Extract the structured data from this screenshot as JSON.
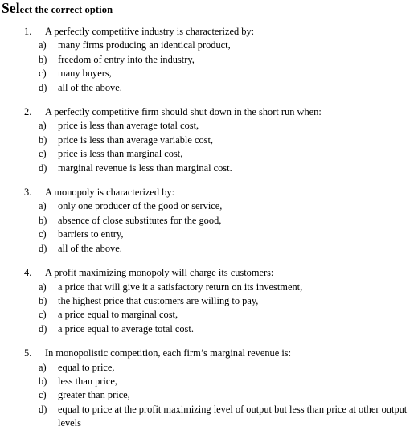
{
  "document": {
    "title_lead": "Sel",
    "title_rest": "ect the correct option",
    "title_full": "Select the correct option",
    "background_color": "#ffffff",
    "text_color": "#000000"
  },
  "questions": [
    {
      "number": "1.",
      "stem": "A perfectly competitive industry is characterized by:",
      "extra_gap_before": false,
      "options": [
        {
          "letter": "a)",
          "text": "many firms producing an identical product,"
        },
        {
          "letter": "b)",
          "text": "freedom of entry into the industry,"
        },
        {
          "letter": "c)",
          "text": "many buyers,"
        },
        {
          "letter": "d)",
          "text": "all of the above."
        }
      ]
    },
    {
      "number": "2.",
      "stem": "A perfectly competitive firm should shut down in the short run when:",
      "extra_gap_before": false,
      "options": [
        {
          "letter": "a)",
          "text": "price is less than average total cost,"
        },
        {
          "letter": "b)",
          "text": "price is less than average variable cost,"
        },
        {
          "letter": "c)",
          "text": "price is less than marginal cost,"
        },
        {
          "letter": "d)",
          "text": "marginal revenue is less than marginal cost."
        }
      ]
    },
    {
      "number": "3.",
      "stem": "A monopoly is characterized by:",
      "extra_gap_before": false,
      "options": [
        {
          "letter": "a)",
          "text": "only one producer of the good or service,"
        },
        {
          "letter": "b)",
          "text": "absence of close substitutes for the good,"
        },
        {
          "letter": "c)",
          "text": "barriers to entry,"
        },
        {
          "letter": "d)",
          "text": "all of the above."
        }
      ]
    },
    {
      "number": "4.",
      "stem": "A profit maximizing monopoly will charge its customers:",
      "extra_gap_before": true,
      "options": [
        {
          "letter": "a)",
          "text": "a price that will give it a satisfactory return on its investment,"
        },
        {
          "letter": "b)",
          "text": "the highest price that customers are willing to pay,"
        },
        {
          "letter": "c)",
          "text": "a price equal to marginal cost,"
        },
        {
          "letter": "d)",
          "text": "a price equal to average total cost."
        }
      ]
    },
    {
      "number": "5.",
      "stem": "In monopolistic competition, each firm’s marginal revenue is:",
      "extra_gap_before": false,
      "options": [
        {
          "letter": "a)",
          "text": "equal to price,"
        },
        {
          "letter": "b)",
          "text": "less than price,"
        },
        {
          "letter": "c)",
          "text": "greater than price,"
        },
        {
          "letter": "d)",
          "text": "equal to price at the profit maximizing level of output but less than price at other output levels",
          "wraps": true
        }
      ]
    }
  ]
}
